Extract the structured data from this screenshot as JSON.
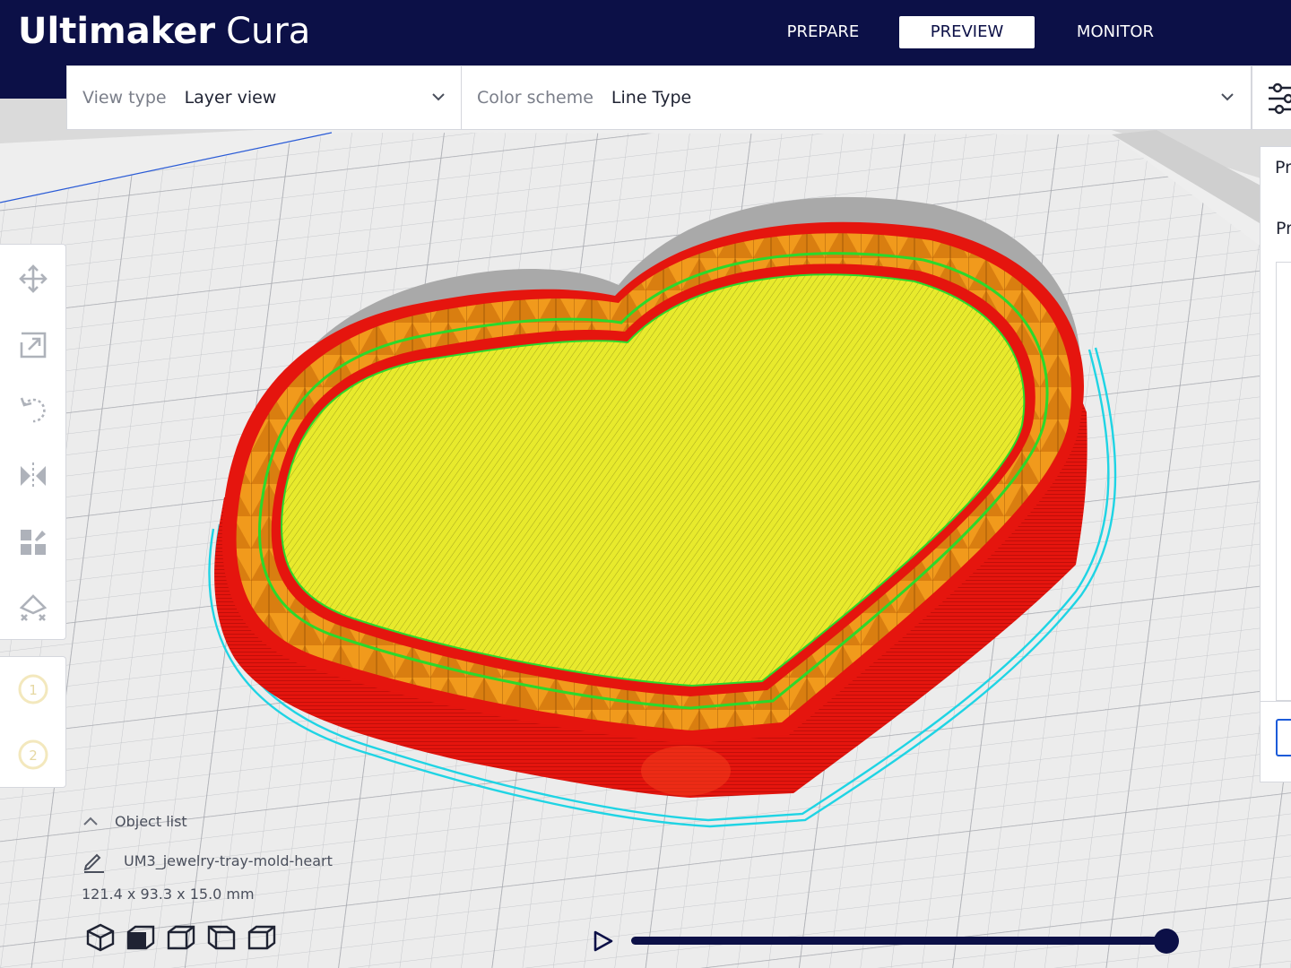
{
  "app": {
    "brand": "Ultimaker",
    "product": "Cura"
  },
  "stages": [
    {
      "label": "PREPARE",
      "active": false
    },
    {
      "label": "PREVIEW",
      "active": true
    },
    {
      "label": "MONITOR",
      "active": false
    }
  ],
  "view_toolbar": {
    "view_type_label": "View type",
    "view_type_value": "Layer view",
    "color_scheme_label": "Color scheme",
    "color_scheme_value": "Line Type"
  },
  "print_panel": {
    "title_partial": "Pr",
    "subtitle_partial": "Pr"
  },
  "tools": [
    "move-icon",
    "scale-icon",
    "rotate-icon",
    "mirror-icon",
    "per-model-settings-icon",
    "support-blocker-icon"
  ],
  "extruders": [
    "1",
    "2"
  ],
  "object_list": {
    "header": "Object list",
    "item_name": "UM3_jewelry-tray-mold-heart",
    "dimensions": "121.4 x 93.3 x 15.0 mm"
  },
  "layer_slider": {
    "value_fraction": 1.0
  },
  "colors": {
    "header_bg": "#0c1047",
    "accent": "#1c5bd9",
    "wall_outer": "#e8130d",
    "infill": "#f0a020",
    "top_bottom": "#e6e82a",
    "wall_inner": "#2bd92b",
    "skirt": "#22d6e6",
    "build_plate": "#ececec",
    "shadow": "#a8a8a8"
  }
}
